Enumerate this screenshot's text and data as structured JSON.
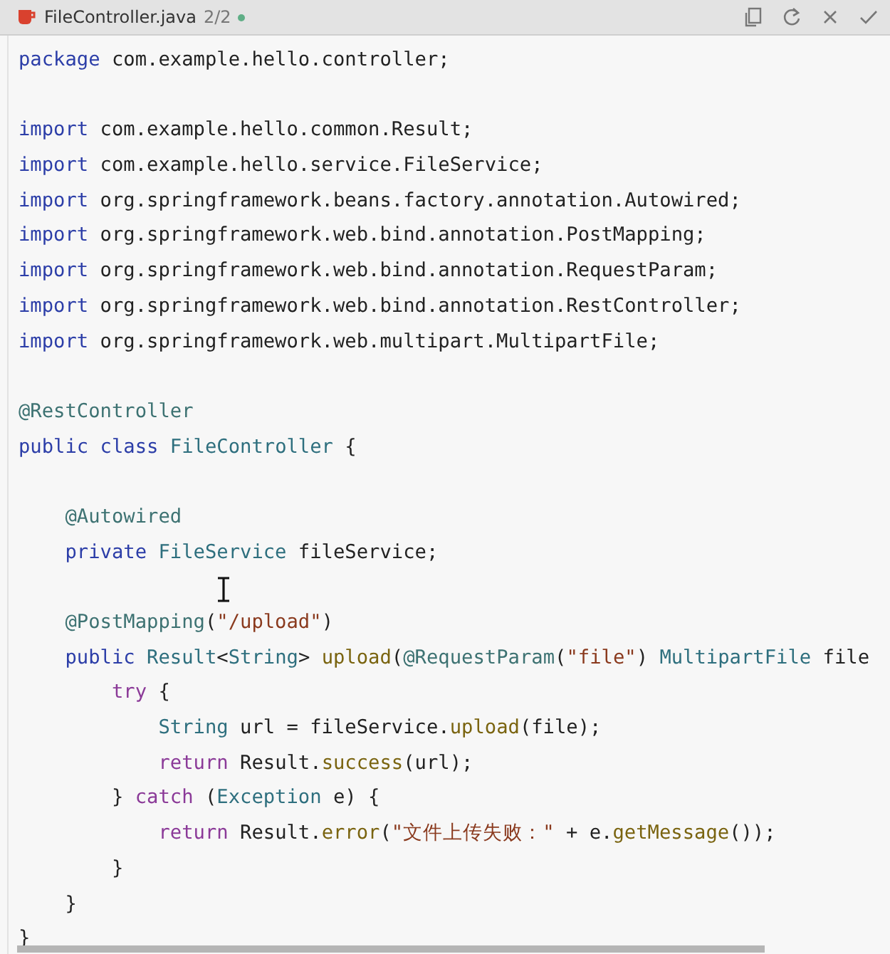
{
  "tab": {
    "title": "FileController.java",
    "counter": "2/2",
    "modified": true
  },
  "code": [
    {
      "kind": "code",
      "tokens": [
        {
          "kind": "kw",
          "text": "package"
        },
        {
          "kind": "p",
          "text": " com.example.hello.controller;"
        }
      ]
    },
    {
      "kind": "blank"
    },
    {
      "kind": "code",
      "tokens": [
        {
          "kind": "kw",
          "text": "import"
        },
        {
          "kind": "p",
          "text": " com.example.hello.common.Result;"
        }
      ]
    },
    {
      "kind": "code",
      "tokens": [
        {
          "kind": "kw",
          "text": "import"
        },
        {
          "kind": "p",
          "text": " com.example.hello.service.FileService;"
        }
      ]
    },
    {
      "kind": "code",
      "tokens": [
        {
          "kind": "kw",
          "text": "import"
        },
        {
          "kind": "p",
          "text": " org.springframework.beans.factory.annotation.Autowired;"
        }
      ]
    },
    {
      "kind": "code",
      "tokens": [
        {
          "kind": "kw",
          "text": "import"
        },
        {
          "kind": "p",
          "text": " org.springframework.web.bind.annotation.PostMapping;"
        }
      ]
    },
    {
      "kind": "code",
      "tokens": [
        {
          "kind": "kw",
          "text": "import"
        },
        {
          "kind": "p",
          "text": " org.springframework.web.bind.annotation.RequestParam;"
        }
      ]
    },
    {
      "kind": "code",
      "tokens": [
        {
          "kind": "kw",
          "text": "import"
        },
        {
          "kind": "p",
          "text": " org.springframework.web.bind.annotation.RestController;"
        }
      ]
    },
    {
      "kind": "code",
      "tokens": [
        {
          "kind": "kw",
          "text": "import"
        },
        {
          "kind": "p",
          "text": " org.springframework.web.multipart.MultipartFile;"
        }
      ]
    },
    {
      "kind": "blank"
    },
    {
      "kind": "code",
      "tokens": [
        {
          "kind": "an",
          "text": "@RestController"
        }
      ]
    },
    {
      "kind": "code",
      "tokens": [
        {
          "kind": "kw",
          "text": "public class "
        },
        {
          "kind": "ty",
          "text": "FileController"
        },
        {
          "kind": "p",
          "text": " {"
        }
      ]
    },
    {
      "kind": "blank"
    },
    {
      "kind": "code",
      "tokens": [
        {
          "kind": "an",
          "text": "    @Autowired"
        }
      ]
    },
    {
      "kind": "code",
      "tokens": [
        {
          "kind": "kw",
          "text": "    private "
        },
        {
          "kind": "ty",
          "text": "FileService"
        },
        {
          "kind": "p",
          "text": " fileService;"
        }
      ]
    },
    {
      "kind": "blank"
    },
    {
      "kind": "code",
      "tokens": [
        {
          "kind": "an",
          "text": "    @PostMapping"
        },
        {
          "kind": "p",
          "text": "("
        },
        {
          "kind": "st",
          "text": "\"/upload\""
        },
        {
          "kind": "p",
          "text": ")"
        }
      ]
    },
    {
      "kind": "code",
      "tokens": [
        {
          "kind": "kw",
          "text": "    public "
        },
        {
          "kind": "ty",
          "text": "Result"
        },
        {
          "kind": "p",
          "text": "<"
        },
        {
          "kind": "ty",
          "text": "String"
        },
        {
          "kind": "p",
          "text": "> "
        },
        {
          "kind": "fn",
          "text": "upload"
        },
        {
          "kind": "p",
          "text": "("
        },
        {
          "kind": "an",
          "text": "@RequestParam"
        },
        {
          "kind": "p",
          "text": "("
        },
        {
          "kind": "st",
          "text": "\"file\""
        },
        {
          "kind": "p",
          "text": ") "
        },
        {
          "kind": "ty",
          "text": "MultipartFile"
        },
        {
          "kind": "p",
          "text": " file"
        }
      ]
    },
    {
      "kind": "code",
      "tokens": [
        {
          "kind": "ctl",
          "text": "        try"
        },
        {
          "kind": "p",
          "text": " {"
        }
      ]
    },
    {
      "kind": "code",
      "tokens": [
        {
          "kind": "ty",
          "text": "            String"
        },
        {
          "kind": "p",
          "text": " url = fileService."
        },
        {
          "kind": "fn",
          "text": "upload"
        },
        {
          "kind": "p",
          "text": "(file);"
        }
      ]
    },
    {
      "kind": "code",
      "tokens": [
        {
          "kind": "ctl",
          "text": "            return"
        },
        {
          "kind": "p",
          "text": " Result."
        },
        {
          "kind": "fn",
          "text": "success"
        },
        {
          "kind": "p",
          "text": "(url);"
        }
      ]
    },
    {
      "kind": "code",
      "tokens": [
        {
          "kind": "p",
          "text": "        } "
        },
        {
          "kind": "ctl",
          "text": "catch"
        },
        {
          "kind": "p",
          "text": " ("
        },
        {
          "kind": "ty",
          "text": "Exception"
        },
        {
          "kind": "p",
          "text": " e) {"
        }
      ]
    },
    {
      "kind": "code",
      "tokens": [
        {
          "kind": "ctl",
          "text": "            return"
        },
        {
          "kind": "p",
          "text": " Result."
        },
        {
          "kind": "fn",
          "text": "error"
        },
        {
          "kind": "p",
          "text": "("
        },
        {
          "kind": "st",
          "text": "\"文件上传失败：\""
        },
        {
          "kind": "p",
          "text": " + e."
        },
        {
          "kind": "fn",
          "text": "getMessage"
        },
        {
          "kind": "p",
          "text": "());"
        }
      ]
    },
    {
      "kind": "code",
      "tokens": [
        {
          "kind": "p",
          "text": "        }"
        }
      ]
    },
    {
      "kind": "code",
      "tokens": [
        {
          "kind": "p",
          "text": "    }"
        }
      ]
    },
    {
      "kind": "code",
      "tokens": [
        {
          "kind": "p",
          "text": "}"
        }
      ]
    }
  ]
}
